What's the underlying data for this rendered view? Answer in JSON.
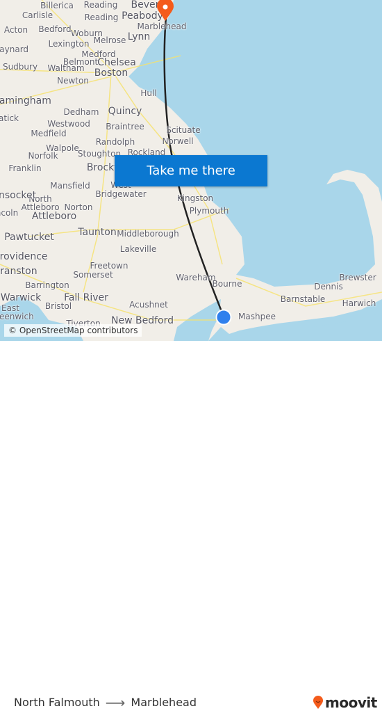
{
  "map": {
    "labels": [
      "Billerica",
      "Reading",
      "Beverly",
      "Carlisle",
      "Reading",
      "Peabody",
      "Acton",
      "Bedford",
      "Woburn",
      "Marblehead",
      "Lexington",
      "Melrose",
      "Lynn",
      "Maynard",
      "Medford",
      "Belmont",
      "Chelsea",
      "Sudbury",
      "Waltham",
      "Boston",
      "Newton",
      "Hull",
      "Framingham",
      "Dedham",
      "Quincy",
      "Natick",
      "Westwood",
      "Braintree",
      "Scituate",
      "Medfield",
      "Walpole",
      "Randolph",
      "Norwell",
      "Norfolk",
      "Stoughton",
      "Rockland",
      "Franklin",
      "Brockton",
      "Mansfield",
      "West Bridgewater",
      "Kingston",
      "North Attleboro",
      "Norton",
      "Woonsocket",
      "Attleboro",
      "Plymouth",
      "Lincoln",
      "Taunton",
      "Middleborough",
      "Pawtucket",
      "Lakeville",
      "Providence",
      "Freetown",
      "Cranston",
      "Somerset",
      "Wareham",
      "Bourne",
      "Brewster",
      "Barrington",
      "Dennis",
      "Warwick",
      "Fall River",
      "Bristol",
      "Acushnet",
      "Barnstable",
      "Harwich",
      "East Greenwich",
      "Tiverton",
      "New Bedford",
      "Mashpee"
    ],
    "attribution": "© OpenStreetMap contributors",
    "cta_label": "Take me there",
    "colors": {
      "land": "#f1eee8",
      "water": "#a9d6ea",
      "route": "#222222",
      "origin": "#2f80ed",
      "destination": "#f45b1b",
      "button": "#0b78d1"
    }
  },
  "footer": {
    "origin": "North Falmouth",
    "destination": "Marblehead",
    "arrow_icon": "arrow-right-icon",
    "brand": "moovit"
  }
}
